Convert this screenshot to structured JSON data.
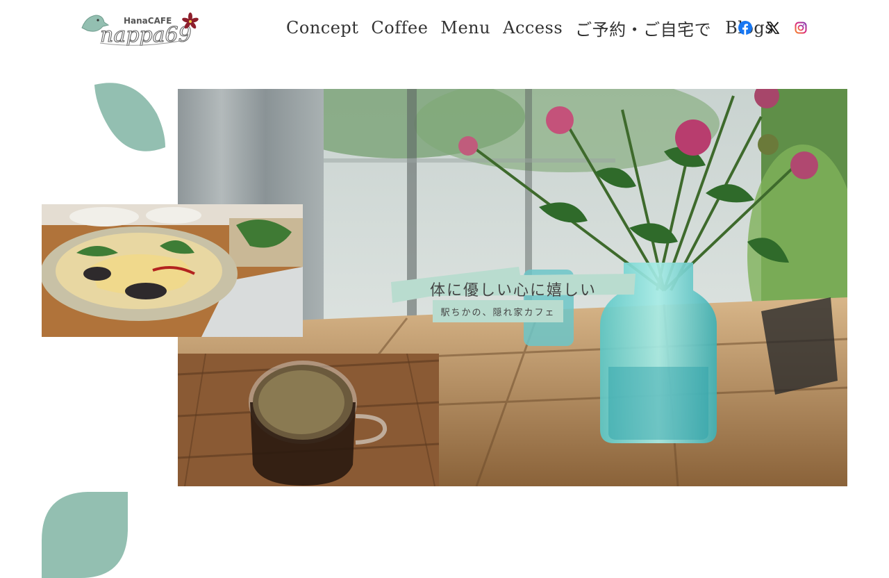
{
  "header": {
    "logo": {
      "brand_small": "HanaCAFE",
      "brand_large": "nappa69"
    },
    "nav": [
      {
        "label": "Concept"
      },
      {
        "label": "Coffee"
      },
      {
        "label": "Menu"
      },
      {
        "label": "Access"
      },
      {
        "label": "ご予約・ご自宅で"
      },
      {
        "label": "Blogs"
      }
    ],
    "social": [
      {
        "icon": "facebook-icon",
        "color": "#1877F2"
      },
      {
        "icon": "x-icon",
        "color": "#111111"
      },
      {
        "icon": "instagram-icon",
        "color": "#D6249F"
      }
    ]
  },
  "hero": {
    "tagline": "体に優しい心に嬉しい",
    "subtagline": "駅ちかの、隠れ家カフェ",
    "images": [
      "flowers-in-vase-photo",
      "pasta-dish-photo",
      "coffee-cup-photo"
    ]
  },
  "theme": {
    "leaf_color": "#93bfb1",
    "tagline_band_color": "#b9dccf",
    "logo_accent": "#8e1f2c"
  }
}
